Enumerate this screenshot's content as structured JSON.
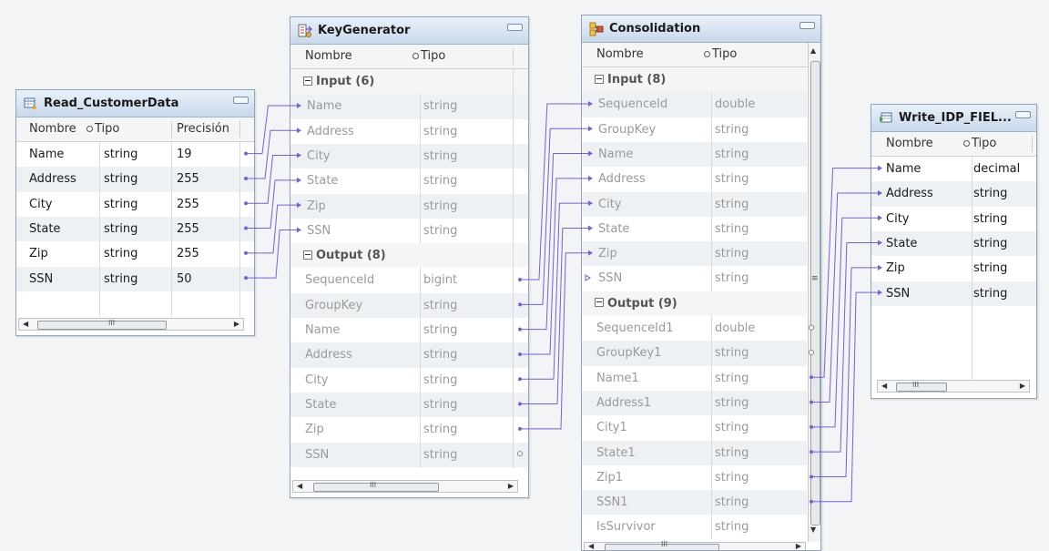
{
  "colors": {
    "link": "#7a5ed8",
    "title_bg": "#c8d8ea",
    "alt_row": "#eef1f4"
  },
  "read": {
    "title": "Read_CustomerData",
    "icon": "data-object-icon",
    "headers": {
      "name": "Nombre",
      "type": "Tipo",
      "precision": "Precisión"
    },
    "rows": [
      {
        "name": "Name",
        "type": "string",
        "precision": "19"
      },
      {
        "name": "Address",
        "type": "string",
        "precision": "255"
      },
      {
        "name": "City",
        "type": "string",
        "precision": "255"
      },
      {
        "name": "State",
        "type": "string",
        "precision": "255"
      },
      {
        "name": "Zip",
        "type": "string",
        "precision": "255"
      },
      {
        "name": "SSN",
        "type": "string",
        "precision": "50"
      }
    ]
  },
  "keygen": {
    "title": "KeyGenerator",
    "icon": "key-generator-icon",
    "headers": {
      "name": "Nombre",
      "type": "Tipo"
    },
    "input_label": "Input (6)",
    "output_label": "Output (8)",
    "input": [
      {
        "name": "Name",
        "type": "string"
      },
      {
        "name": "Address",
        "type": "string"
      },
      {
        "name": "City",
        "type": "string"
      },
      {
        "name": "State",
        "type": "string"
      },
      {
        "name": "Zip",
        "type": "string"
      },
      {
        "name": "SSN",
        "type": "string"
      }
    ],
    "output": [
      {
        "name": "SequenceId",
        "type": "bigint"
      },
      {
        "name": "GroupKey",
        "type": "string"
      },
      {
        "name": "Name",
        "type": "string"
      },
      {
        "name": "Address",
        "type": "string"
      },
      {
        "name": "City",
        "type": "string"
      },
      {
        "name": "State",
        "type": "string"
      },
      {
        "name": "Zip",
        "type": "string"
      },
      {
        "name": "SSN",
        "type": "string"
      }
    ]
  },
  "consol": {
    "title": "Consolidation",
    "icon": "consolidation-icon",
    "headers": {
      "name": "Nombre",
      "type": "Tipo"
    },
    "input_label": "Input (8)",
    "output_label": "Output (9)",
    "input": [
      {
        "name": "SequenceId",
        "type": "double"
      },
      {
        "name": "GroupKey",
        "type": "string"
      },
      {
        "name": "Name",
        "type": "string"
      },
      {
        "name": "Address",
        "type": "string"
      },
      {
        "name": "City",
        "type": "string"
      },
      {
        "name": "State",
        "type": "string"
      },
      {
        "name": "Zip",
        "type": "string"
      },
      {
        "name": "SSN",
        "type": "string"
      }
    ],
    "output": [
      {
        "name": "SequenceId1",
        "type": "double"
      },
      {
        "name": "GroupKey1",
        "type": "string"
      },
      {
        "name": "Name1",
        "type": "string"
      },
      {
        "name": "Address1",
        "type": "string"
      },
      {
        "name": "City1",
        "type": "string"
      },
      {
        "name": "State1",
        "type": "string"
      },
      {
        "name": "Zip1",
        "type": "string"
      },
      {
        "name": "SSN1",
        "type": "string"
      },
      {
        "name": "IsSurvivor",
        "type": "string"
      }
    ]
  },
  "write": {
    "title": "Write_IDP_FIEL...",
    "icon": "data-object-write-icon",
    "headers": {
      "name": "Nombre",
      "type": "Tipo"
    },
    "rows": [
      {
        "name": "Name",
        "type": "decimal"
      },
      {
        "name": "Address",
        "type": "string"
      },
      {
        "name": "City",
        "type": "string"
      },
      {
        "name": "State",
        "type": "string"
      },
      {
        "name": "Zip",
        "type": "string"
      },
      {
        "name": "SSN",
        "type": "string"
      }
    ]
  },
  "scrollbar_grip": "III"
}
